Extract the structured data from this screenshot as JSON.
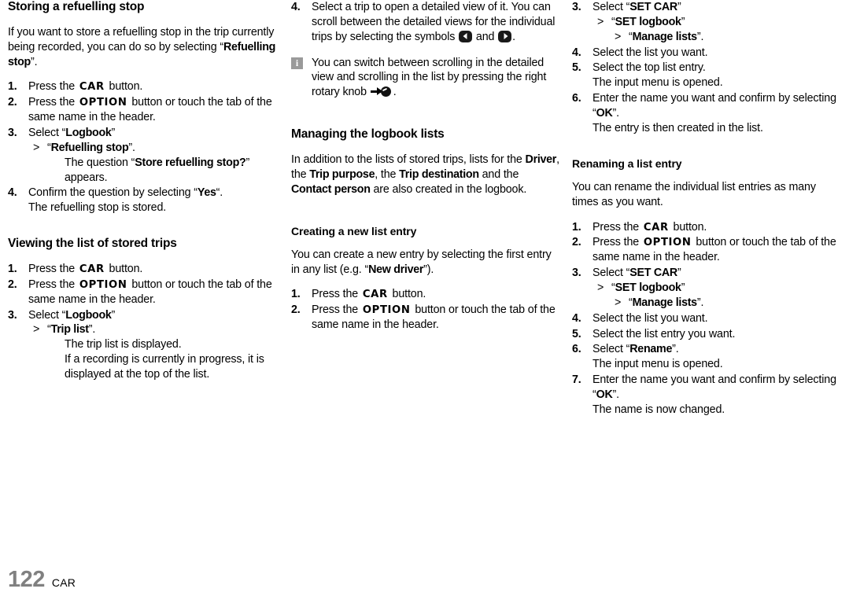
{
  "page": {
    "folio_number": "122",
    "folio_label": "CAR"
  },
  "symbols": {
    "info": "i",
    "gt": ">",
    "arrow_left_name": "scroll-left-symbol",
    "arrow_right_name": "scroll-right-symbol",
    "knob_name": "press-rotary-knob-symbol"
  },
  "buttons": {
    "car": "CAR",
    "option": "OPTION"
  },
  "column_1": {
    "section_1": {
      "heading": "Storing a refuelling stop",
      "intro_a": "If you want to store a refuelling stop in the trip currently being recorded, you can do so by selecting “",
      "intro_bold": "Refuelling stop",
      "intro_b": "”.",
      "steps": [
        {
          "num": "1.",
          "pre": "Press the",
          "button": "CAR",
          "post": "button."
        },
        {
          "num": "2.",
          "pre": "Press the",
          "button": "OPTION",
          "post": "button or touch the tab of the same name in the header."
        },
        {
          "num": "3.",
          "pre": "Select “",
          "bold": "Logbook",
          "post": "”",
          "sub": {
            "pre": "“",
            "bold": "Refuelling stop",
            "post": "”."
          },
          "detail_a": "The question “",
          "detail_bold": "Store refuelling stop?",
          "detail_b": "” appears."
        },
        {
          "num": "4.",
          "pre": "Confirm the question by selecting “",
          "bold": "Yes",
          "post": "“.",
          "detail": "The refuelling stop is stored."
        }
      ]
    },
    "section_2": {
      "heading": "Viewing the list of stored trips",
      "steps": [
        {
          "num": "1.",
          "pre": "Press the",
          "button": "CAR",
          "post": "button."
        },
        {
          "num": "2.",
          "pre": "Press the",
          "button": "OPTION",
          "post": "button or touch the tab of the same name in the header."
        },
        {
          "num": "3.",
          "pre": "Select “",
          "bold": "Logbook",
          "post": "”",
          "sub": {
            "pre": "“",
            "bold": "Trip list",
            "post": "”."
          },
          "detail_1": "The trip list is displayed.",
          "detail_2": "If a recording is currently in progress, it is displayed at the top of the list."
        }
      ]
    }
  },
  "column_2": {
    "step_4": {
      "num": "4.",
      "text_a": "Select a trip to open a detailed view of it. You can scroll between the detailed views for the individual trips by selecting the symbols",
      "text_and": "and",
      "text_end": "."
    },
    "note": {
      "text_a": "You can switch between scrolling in the detailed view and scrolling in the list by pressing the right rotary knob",
      "text_end": "."
    },
    "section": {
      "heading": "Managing the logbook lists",
      "intro_a": "In addition to the lists of stored trips, lists for the ",
      "intro_b1": "Driver",
      "intro_b2": ", the ",
      "intro_b3": "Trip purpose",
      "intro_b4": ", the ",
      "intro_b5": "Trip destination",
      "intro_b6": " and the ",
      "intro_b7": "Contact person",
      "intro_b8": " are also created in the logbook."
    },
    "subsection": {
      "heading": "Creating a new list entry",
      "intro_a": "You can create a new entry by selecting the first entry in any list (e.g. “",
      "intro_bold": "New driver",
      "intro_b": "”).",
      "steps": [
        {
          "num": "1.",
          "pre": "Press the",
          "button": "CAR",
          "post": "button."
        },
        {
          "num": "2.",
          "pre": "Press the",
          "button": "OPTION",
          "post": "button or touch the tab of the same name in the header."
        }
      ]
    }
  },
  "column_3": {
    "creating_steps": [
      {
        "num": "3.",
        "pre": "Select “",
        "bold": "SET CAR",
        "post": "”",
        "sub_1": {
          "pre": "“",
          "bold": "SET logbook",
          "post": "”"
        },
        "sub_2": {
          "pre": "“",
          "bold": "Manage lists",
          "post": "”."
        }
      },
      {
        "num": "4.",
        "text": "Select the list you want."
      },
      {
        "num": "5.",
        "text": "Select the top list entry.",
        "detail": "The input menu is opened."
      },
      {
        "num": "6.",
        "pre": "Enter the name you want and confirm by selecting “",
        "bold": "OK",
        "post": "”.",
        "detail": "The entry is then created in the list."
      }
    ],
    "subsection": {
      "heading": "Renaming a list entry",
      "intro": "You can rename the individual list entries as many times as you want.",
      "steps": [
        {
          "num": "1.",
          "pre": "Press the",
          "button": "CAR",
          "post": "button."
        },
        {
          "num": "2.",
          "pre": "Press the",
          "button": "OPTION",
          "post": "button or touch the tab of the same name in the header."
        },
        {
          "num": "3.",
          "pre": "Select “",
          "bold": "SET CAR",
          "post": "”",
          "sub_1": {
            "pre": "“",
            "bold": "SET logbook",
            "post": "”"
          },
          "sub_2": {
            "pre": "“",
            "bold": "Manage lists",
            "post": "”."
          }
        },
        {
          "num": "4.",
          "text": "Select the list you want."
        },
        {
          "num": "5.",
          "text": "Select the list entry you want."
        },
        {
          "num": "6.",
          "pre": "Select “",
          "bold": "Rename",
          "post": "”.",
          "detail": "The input menu is opened."
        },
        {
          "num": "7.",
          "pre": "Enter the name you want and confirm by selecting “",
          "bold": "OK",
          "post": "”.",
          "detail": "The name is now changed."
        }
      ]
    }
  }
}
